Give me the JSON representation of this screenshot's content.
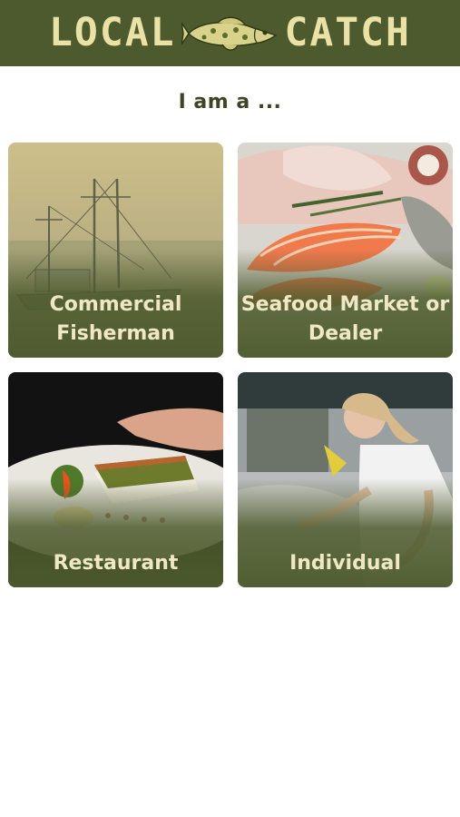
{
  "header": {
    "brand_left": "LOCAL",
    "brand_right": "CATCH",
    "logo_icon": "fish-icon"
  },
  "prompt": "I am a ...",
  "options": [
    {
      "id": "commercial_fisherman",
      "label": "Commercial\nFisherman"
    },
    {
      "id": "seafood_market",
      "label": "Seafood Market or\nDealer"
    },
    {
      "id": "restaurant",
      "label": "Restaurant"
    },
    {
      "id": "individual",
      "label": "Individual"
    }
  ],
  "colors": {
    "brand": "#4d5a2d",
    "brand_text": "#e9e1a6",
    "prompt_text": "#3e4526",
    "card_text": "#efe8c4"
  }
}
